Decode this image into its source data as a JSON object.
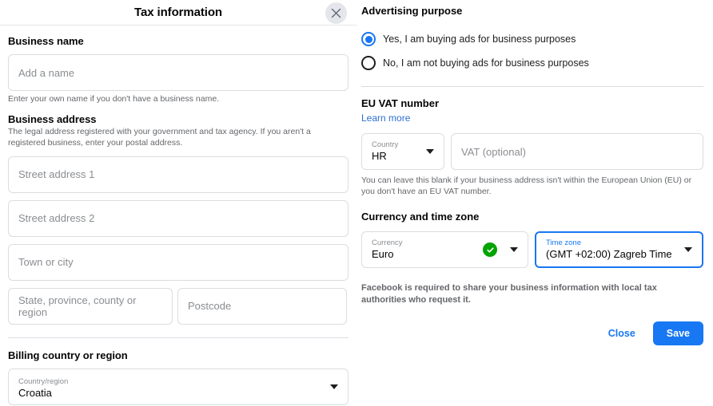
{
  "header": {
    "title": "Tax information",
    "close_icon": "close-icon"
  },
  "left": {
    "business_name": {
      "title": "Business name",
      "input_placeholder": "Add a name",
      "helper": "Enter your own name if you don't have a business name."
    },
    "business_address": {
      "title": "Business address",
      "helper": "The legal address registered with your government and tax agency. If you aren't a registered business, enter your postal address.",
      "street1_placeholder": "Street address 1",
      "street2_placeholder": "Street address 2",
      "city_placeholder": "Town or city",
      "state_placeholder": "State, province, county or region",
      "postcode_placeholder": "Postcode"
    },
    "billing_country": {
      "title": "Billing country or region",
      "field_label": "Country/region",
      "field_value": "Croatia",
      "caret_icon": "chevron-down-icon"
    }
  },
  "right": {
    "advertising_purpose": {
      "title": "Advertising purpose",
      "options": [
        {
          "label": "Yes, I am buying ads for business purposes",
          "selected": true
        },
        {
          "label": "No, I am not buying ads for business purposes",
          "selected": false
        }
      ]
    },
    "eu_vat": {
      "title": "EU VAT number",
      "learn_more": "Learn more",
      "country_label": "Country",
      "country_value": "HR",
      "vat_placeholder": "VAT (optional)",
      "helper": "You can leave this blank if your business address isn't within the European Union (EU) or you don't have an EU VAT number."
    },
    "currency_timezone": {
      "title": "Currency and time zone",
      "currency_label": "Currency",
      "currency_value": "Euro",
      "currency_valid_icon": "check-circle-icon",
      "timezone_label": "Time zone",
      "timezone_value": "(GMT +02:00) Zagreb Time",
      "caret_icon": "chevron-down-icon"
    },
    "notice": "Facebook is required to share your business information with local tax authorities who request it.",
    "buttons": {
      "close_label": "Close",
      "save_label": "Save"
    }
  },
  "colors": {
    "brand_blue": "#1877f2",
    "link_blue": "#2d70d2",
    "success_green": "#00a400",
    "border_grey": "#dadde1",
    "text_secondary": "#65676b"
  }
}
